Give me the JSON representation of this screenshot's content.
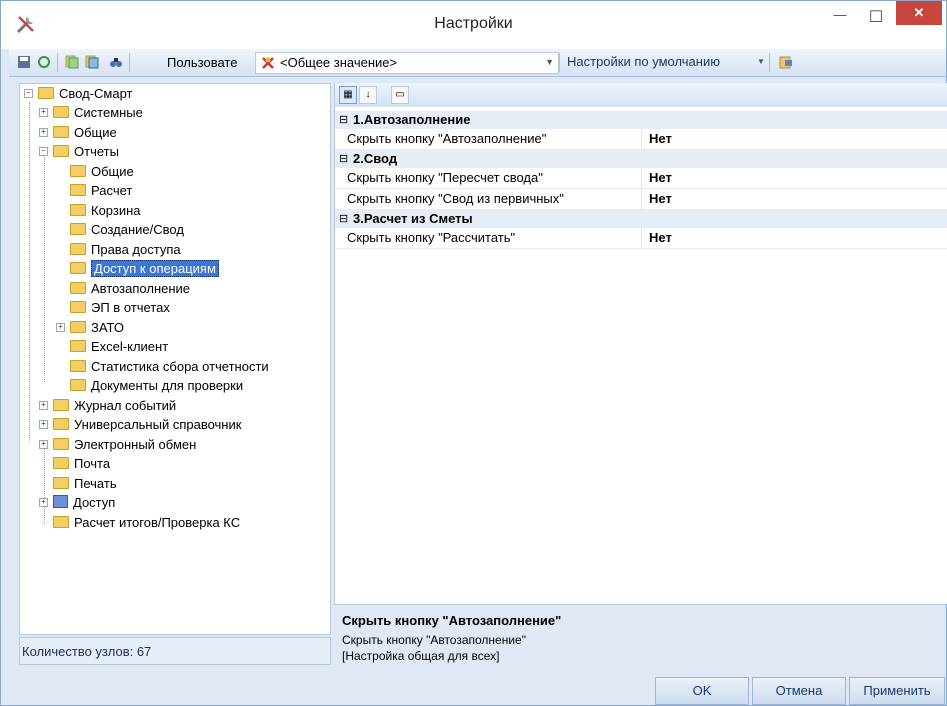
{
  "window": {
    "title": "Настройки",
    "minimize": "—",
    "maximize": "☐",
    "close": "✕"
  },
  "toolbar": {
    "user_label": "Пользовате",
    "scope_value": "<Общее значение>",
    "defaults_label": "Настройки по умолчанию",
    "icons": [
      "save-icon",
      "refresh-icon",
      "copy-icon",
      "paste-icon",
      "find-icon",
      "user-scope-icon",
      "export-icon"
    ]
  },
  "tree": {
    "root": "Свод-Смарт",
    "n1": "Системные",
    "n2": "Общие",
    "n3": "Отчеты",
    "n3a": "Общие",
    "n3b": "Расчет",
    "n3c": "Корзина",
    "n3d": "Создание/Свод",
    "n3e": "Права доступа",
    "n3f": "Доступ к операциям",
    "n3g": "Автозаполнение",
    "n3h": "ЭП в отчетах",
    "n3i": "ЗАТО",
    "n3j": "Excel-клиент",
    "n3k": "Статистика сбора отчетности",
    "n3l": "Документы для проверки",
    "n4": "Журнал событий",
    "n5": "Универсальный справочник",
    "n6": "Электронный обмен",
    "n7": "Почта",
    "n8": "Печать",
    "n9": "Доступ",
    "n10": "Расчет итогов/Проверка КС",
    "selected": "Доступ к операциям"
  },
  "status": {
    "nodes_count": "Количество узлов: 67"
  },
  "grid": {
    "categories": [
      {
        "title": "1.Автозаполнение",
        "props": [
          {
            "name": "Скрыть кнопку \"Автозаполнение\"",
            "value": "Нет"
          }
        ]
      },
      {
        "title": "2.Свод",
        "props": [
          {
            "name": "Скрыть кнопку \"Пересчет свода\"",
            "value": "Нет"
          },
          {
            "name": "Скрыть кнопку \"Свод из первичных\"",
            "value": "Нет"
          }
        ]
      },
      {
        "title": "3.Расчет из Сметы",
        "props": [
          {
            "name": "Скрыть кнопку \"Рассчитать\"",
            "value": "Нет"
          }
        ]
      }
    ],
    "toggle": "⊟"
  },
  "description": {
    "title": "Скрыть кнопку \"Автозаполнение\"",
    "line1": "Скрыть кнопку \"Автозаполнение\"",
    "line2": "[Настройка общая для всех]"
  },
  "buttons": {
    "ok": "OK",
    "cancel": "Отмена",
    "apply": "Применить"
  }
}
